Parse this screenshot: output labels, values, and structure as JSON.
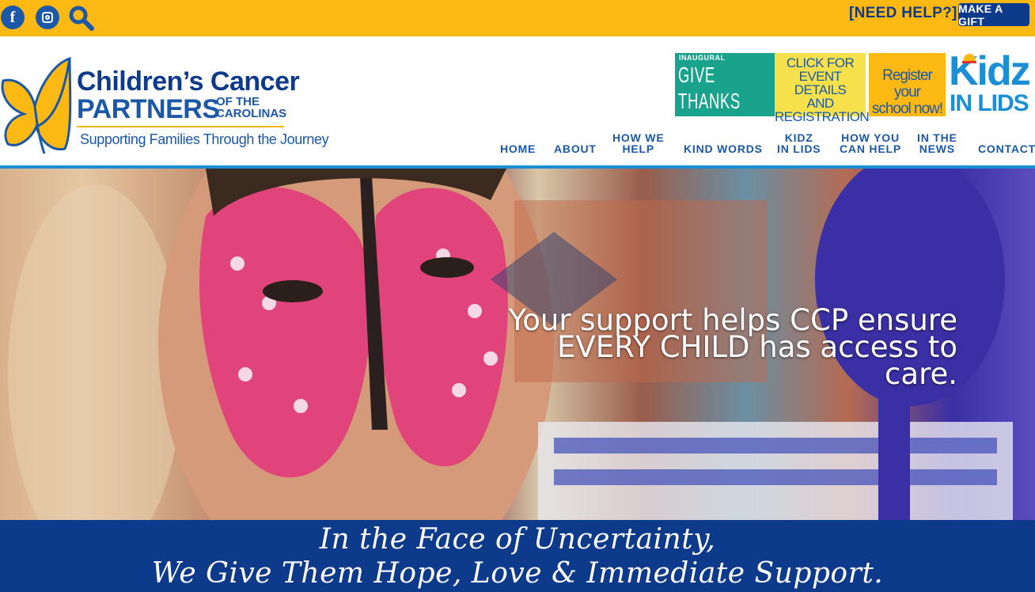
{
  "topbar": {
    "facebook_icon": "f",
    "need_help": "[NEED HELP?]",
    "gift_button": "MAKE A GIFT"
  },
  "logo": {
    "line1": "Children’s Cancer",
    "line2": "PARTNERS",
    "line2_suffix": "OF THE\nCAROLINAS",
    "tagline": "Supporting Families Through the Journey"
  },
  "banners": {
    "golf_small": "INAUGURAL",
    "golf_big": "GIVE THANKS\nGOLF TOURNEY",
    "click": "CLICK FOR\nEVENT DETAILS\nAND\nREGISTRATION",
    "register": "Register your\nschool now!",
    "kidz_word": "Kidz",
    "kidz_in": "IN LIDS"
  },
  "nav": [
    {
      "label": "HOME"
    },
    {
      "label": "ABOUT"
    },
    {
      "label": "HOW WE\nHELP"
    },
    {
      "label": "KIND WORDS"
    },
    {
      "label": "KIDZ\nIN LIDS"
    },
    {
      "label": "HOW YOU\nCAN HELP"
    },
    {
      "label": "IN THE\nNEWS"
    },
    {
      "label": "CONTACT"
    }
  ],
  "hero": {
    "caption": "Your support helps CCP ensure EVERY CHILD has access to care."
  },
  "slogan": {
    "line1": "In the Face of Uncertainty,",
    "line2": "We Give Them Hope, Love & Immediate Support."
  },
  "colors": {
    "topbar": "#fdb913",
    "navy": "#0e3a8c",
    "blue": "#1b59a8",
    "light_blue": "#1b8fd6"
  }
}
